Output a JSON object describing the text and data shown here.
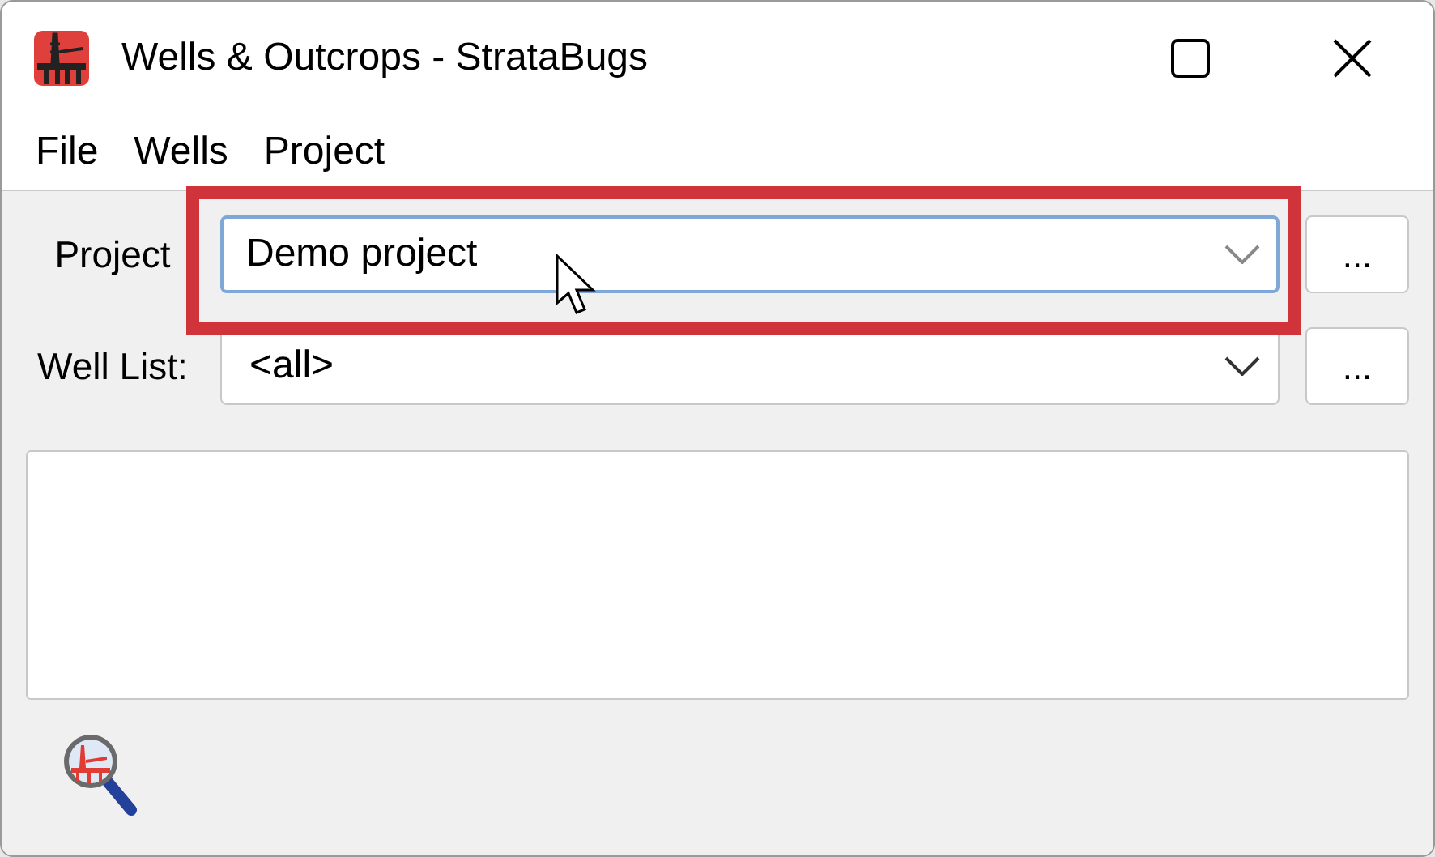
{
  "window": {
    "title": "Wells & Outcrops - StrataBugs"
  },
  "menu": [
    "File",
    "Wells",
    "Project"
  ],
  "fields": [
    {
      "label": "Project",
      "value": "Demo project",
      "focused": true,
      "button": "..."
    },
    {
      "label": "Well List:",
      "value": "<all>",
      "focused": false,
      "button": "..."
    }
  ]
}
